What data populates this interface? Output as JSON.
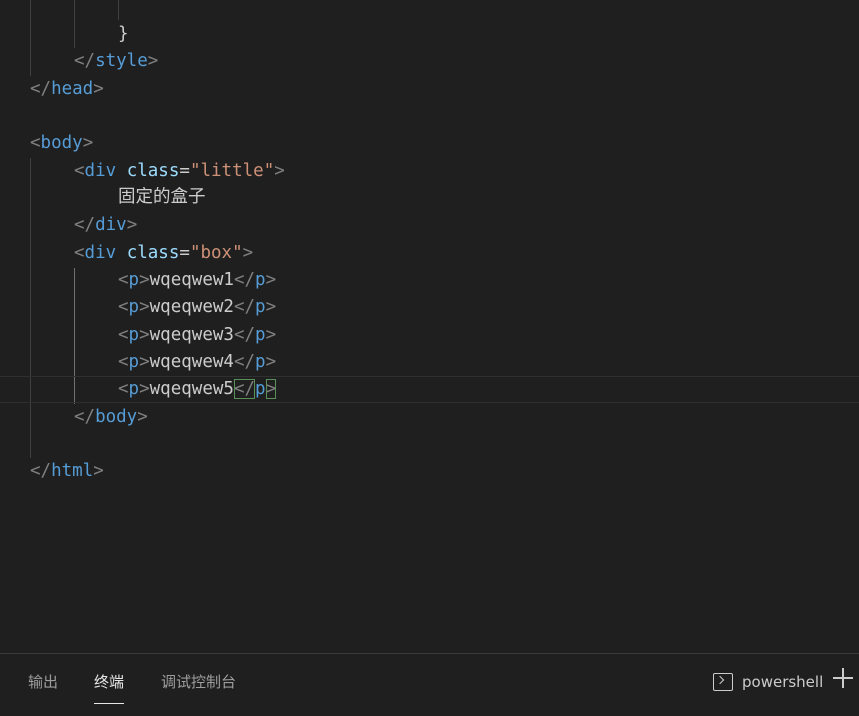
{
  "code": {
    "line_close_brace": "}",
    "line_close_style": {
      "open": "</",
      "tag": "style",
      "close": ">"
    },
    "line_close_head": {
      "open": "</",
      "tag": "head",
      "close": ">"
    },
    "line_body": {
      "open": "<",
      "tag": "body",
      "close": ">"
    },
    "line_div_little": {
      "open": "<",
      "tag": "div",
      "attr": "class",
      "eq": "=",
      "value": "\"little\"",
      "close": ">"
    },
    "line_text": "固定的盒子",
    "line_close_div": {
      "open": "</",
      "tag": "div",
      "close": ">"
    },
    "line_div_box": {
      "open": "<",
      "tag": "div",
      "attr": "class",
      "eq": "=",
      "value": "\"box\"",
      "close": ">"
    },
    "paragraphs": [
      {
        "open": "<",
        "tag": "p",
        "close": ">",
        "text": "wqeqwew1",
        "end_open": "</",
        "end_tag": "p",
        "end_close": ">"
      },
      {
        "open": "<",
        "tag": "p",
        "close": ">",
        "text": "wqeqwew2",
        "end_open": "</",
        "end_tag": "p",
        "end_close": ">"
      },
      {
        "open": "<",
        "tag": "p",
        "close": ">",
        "text": "wqeqwew3",
        "end_open": "</",
        "end_tag": "p",
        "end_close": ">"
      },
      {
        "open": "<",
        "tag": "p",
        "close": ">",
        "text": "wqeqwew4",
        "end_open": "</",
        "end_tag": "p",
        "end_close": ">"
      },
      {
        "open": "<",
        "tag": "p",
        "close": ">",
        "text": "wqeqwew5",
        "end_open": "</",
        "end_tag": "p",
        "end_close": ">"
      }
    ],
    "line_close_body": {
      "open": "</",
      "tag": "body",
      "close": ">"
    },
    "line_close_html": {
      "open": "</",
      "tag": "html",
      "close": ">"
    }
  },
  "panel": {
    "tabs": [
      "输出",
      "终端",
      "调试控制台"
    ],
    "active_tab": "终端",
    "terminal_name": "powershell",
    "terminal_icon": "terminal-icon",
    "add_icon": "plus-icon"
  },
  "colors": {
    "background": "#1f1f1f",
    "tag": "#569cd6",
    "attribute": "#9cdcfe",
    "string": "#ce9178",
    "punctuation": "#808080",
    "text": "#cccccc"
  }
}
